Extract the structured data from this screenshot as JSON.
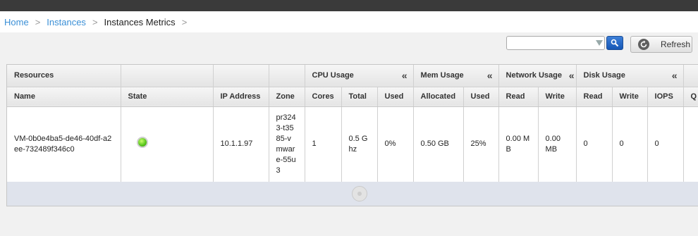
{
  "breadcrumb": {
    "home": "Home",
    "instances": "Instances",
    "current": "Instances Metrics",
    "separator": ">"
  },
  "toolbar": {
    "search_value": "",
    "refresh_label": "Refresh"
  },
  "table": {
    "groups": {
      "resources": "Resources",
      "cpu": "CPU Usage",
      "mem": "Mem Usage",
      "network": "Network Usage",
      "disk": "Disk Usage",
      "collapse": "«"
    },
    "columns": {
      "name": "Name",
      "state": "State",
      "ip": "IP Address",
      "zone": "Zone",
      "cores": "Cores",
      "total": "Total",
      "cpu_used": "Used",
      "allocated": "Allocated",
      "mem_used": "Used",
      "read": "Read",
      "write": "Write",
      "disk_read": "Read",
      "disk_write": "Write",
      "iops": "IOPS",
      "extra": "Q"
    },
    "row": {
      "name": "VM-0b0e4ba5-de46-40df-a2ee-732489f346c0",
      "state": "Running",
      "ip": "10.1.1.97",
      "zone": "pr3243-t3585-vmware-55u3",
      "cores": "1",
      "total": "0.5 Ghz",
      "cpu_used": "0%",
      "allocated": "0.50 GB",
      "mem_used": "25%",
      "net_read": "0.00 MB",
      "net_write": "0.00 MB",
      "disk_read": "0",
      "disk_write": "0",
      "iops": "0"
    }
  },
  "colors": {
    "link": "#3a8fd6",
    "state_running": "#55c41a",
    "search_button": "#1557b5",
    "footer_band": "#dfe3ec"
  }
}
